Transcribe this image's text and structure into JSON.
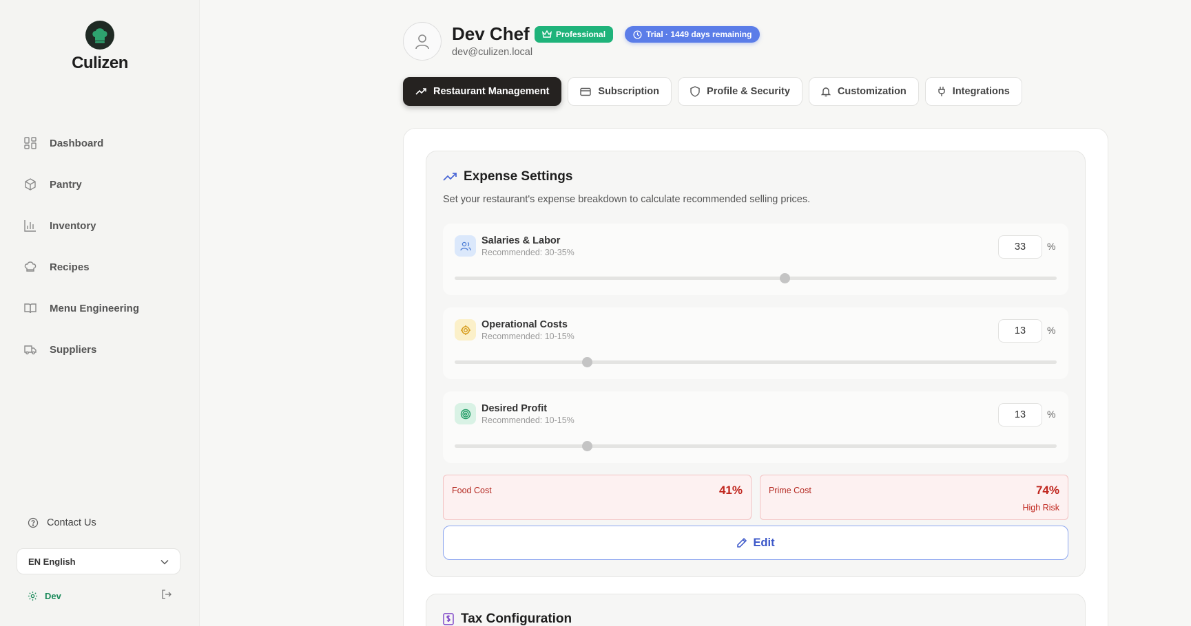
{
  "app": {
    "name": "Culizen"
  },
  "nav": {
    "items": [
      {
        "label": "Dashboard",
        "icon": "dashboard-icon"
      },
      {
        "label": "Pantry",
        "icon": "package-icon"
      },
      {
        "label": "Inventory",
        "icon": "bar-chart-icon"
      },
      {
        "label": "Recipes",
        "icon": "chef-hat-icon"
      },
      {
        "label": "Menu Engineering",
        "icon": "book-icon"
      },
      {
        "label": "Suppliers",
        "icon": "truck-icon"
      }
    ]
  },
  "footer": {
    "contact_label": "Contact Us",
    "language": "EN English",
    "user_label": "Dev"
  },
  "profile": {
    "name": "Dev Chef",
    "email": "dev@culizen.local",
    "plan_badge": "Professional",
    "trial_badge": "Trial · 1449 days remaining"
  },
  "tabs": [
    {
      "label": "Restaurant Management",
      "active": true
    },
    {
      "label": "Subscription",
      "active": false
    },
    {
      "label": "Profile & Security",
      "active": false
    },
    {
      "label": "Customization",
      "active": false
    },
    {
      "label": "Integrations",
      "active": false
    }
  ],
  "expense_settings": {
    "title": "Expense Settings",
    "description": "Set your restaurant's expense breakdown to calculate recommended selling prices.",
    "unit": "%",
    "items": [
      {
        "name": "Salaries & Labor",
        "recommended": "Recommended: 30-35%",
        "value": "33",
        "slider_fraction": 0.548,
        "icon_color": "#dbe8fb"
      },
      {
        "name": "Operational Costs",
        "recommended": "Recommended: 10-15%",
        "value": "13",
        "slider_fraction": 0.22,
        "icon_color": "#fbf0c9"
      },
      {
        "name": "Desired Profit",
        "recommended": "Recommended: 10-15%",
        "value": "13",
        "slider_fraction": 0.22,
        "icon_color": "#d9f2e5"
      }
    ],
    "food_cost": {
      "label": "Food Cost",
      "value": "41%"
    },
    "prime_cost": {
      "label": "Prime Cost",
      "value": "74%",
      "risk": "High Risk"
    },
    "edit_label": "Edit"
  },
  "tax": {
    "title": "Tax Configuration"
  },
  "colors": {
    "accent": "#1fb37a",
    "trial": "#5b7de8",
    "danger": "#c0261e",
    "edit": "#3a56c8"
  }
}
